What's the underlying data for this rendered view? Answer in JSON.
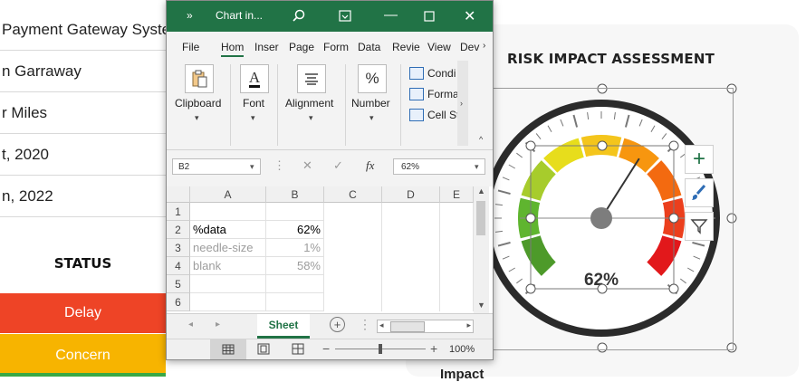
{
  "project_table": {
    "rows": [
      "Payment Gateway Syste",
      "n Garraway",
      "r Miles",
      "t, 2020",
      "n, 2022"
    ]
  },
  "status_section": {
    "header": "STATUS",
    "items": [
      {
        "label": "Delay",
        "color": "#ee4426"
      },
      {
        "label": "Concern",
        "color": "#f7b400"
      }
    ]
  },
  "risk_panel": {
    "title": "RISK IMPACT ASSESSMENT",
    "gauge_value_label": "62%",
    "gauge_value": 62,
    "bottom_label": "Impact"
  },
  "excel": {
    "window_title": "Chart in...",
    "menu_tabs": [
      "File",
      "Hom",
      "Inser",
      "Page",
      "Form",
      "Data",
      "Revie",
      "View",
      "Dev"
    ],
    "ribbon_groups": [
      {
        "label": "Clipboard",
        "icon": "clipboard-icon"
      },
      {
        "label": "Font",
        "icon": "font-color-icon"
      },
      {
        "label": "Alignment",
        "icon": "align-icon"
      },
      {
        "label": "Number",
        "icon": "percent-icon"
      }
    ],
    "styles_items": [
      "Condi",
      "Forma",
      "Cell St"
    ],
    "name_box": "B2",
    "formula_value": "62%",
    "fx_label": "fx",
    "columns": [
      "A",
      "B",
      "C",
      "D",
      "E"
    ],
    "row_numbers": [
      "1",
      "2",
      "3",
      "4",
      "5",
      "6"
    ],
    "cells": [
      {
        "a": "",
        "b": ""
      },
      {
        "a": "%data",
        "b": "62%"
      },
      {
        "a": "needle-size",
        "b": "1%"
      },
      {
        "a": "blank",
        "b": "58%"
      },
      {
        "a": "",
        "b": ""
      },
      {
        "a": "",
        "b": ""
      }
    ],
    "sheet_tab": "Sheet",
    "zoom": "100%"
  }
}
